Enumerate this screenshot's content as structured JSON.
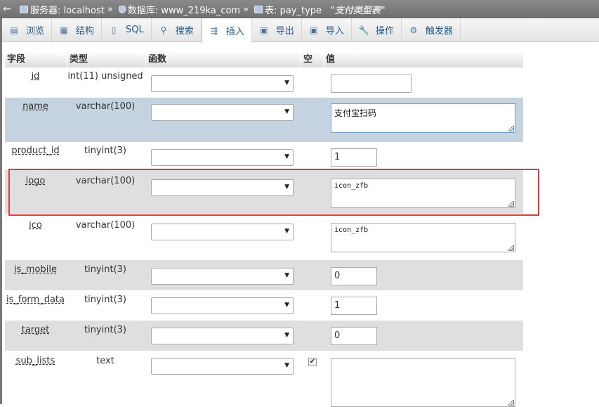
{
  "breadcrumb": {
    "back": "←",
    "server_label": "服务器: localhost",
    "db_label": "数据库: www_219ka_com",
    "table_label": "表: pay_type",
    "table_comment": "\"支付类型表\"",
    "sep": "»"
  },
  "tabs": [
    {
      "label": "浏览",
      "icon": "browse-icon",
      "glyph": "▤"
    },
    {
      "label": "结构",
      "icon": "structure-icon",
      "glyph": "▦"
    },
    {
      "label": "SQL",
      "icon": "sql-icon",
      "glyph": "▯"
    },
    {
      "label": "搜索",
      "icon": "search-icon",
      "glyph": "⚲"
    },
    {
      "label": "插入",
      "icon": "insert-icon",
      "glyph": "⇶"
    },
    {
      "label": "导出",
      "icon": "export-icon",
      "glyph": "▣"
    },
    {
      "label": "导入",
      "icon": "import-icon",
      "glyph": "▣"
    },
    {
      "label": "操作",
      "icon": "operations-icon",
      "glyph": "🔧"
    },
    {
      "label": "触发器",
      "icon": "triggers-icon",
      "glyph": "⚙"
    }
  ],
  "active_tab": "插入",
  "columns": {
    "field": "字段",
    "type": "类型",
    "function": "函数",
    "null": "空",
    "value": "值"
  },
  "rows": [
    {
      "field": "id",
      "type": "int(11) unsigned",
      "value": ""
    },
    {
      "field": "name",
      "type": "varchar(100)",
      "value": "支付宝扫码"
    },
    {
      "field": "product_id",
      "type": "tinyint(3)",
      "value": "1"
    },
    {
      "field": "logo",
      "type": "varchar(100)",
      "value": "icon_zfb"
    },
    {
      "field": "ico",
      "type": "varchar(100)",
      "value": "icon_zfb"
    },
    {
      "field": "is_mobile",
      "type": "tinyint(3)",
      "value": "0"
    },
    {
      "field": "is_form_data",
      "type": "tinyint(3)",
      "value": "1"
    },
    {
      "field": "target",
      "type": "tinyint(3)",
      "value": "0"
    },
    {
      "field": "sub_lists",
      "type": "text",
      "value": "",
      "null_checked": true,
      "null_mark": "✔"
    }
  ],
  "dropdown_arrow": "▼",
  "colors": {
    "highlight_border": "#e03b3b",
    "selected_row": "#c5d2e0",
    "alt_row": "#dfdfdf"
  }
}
